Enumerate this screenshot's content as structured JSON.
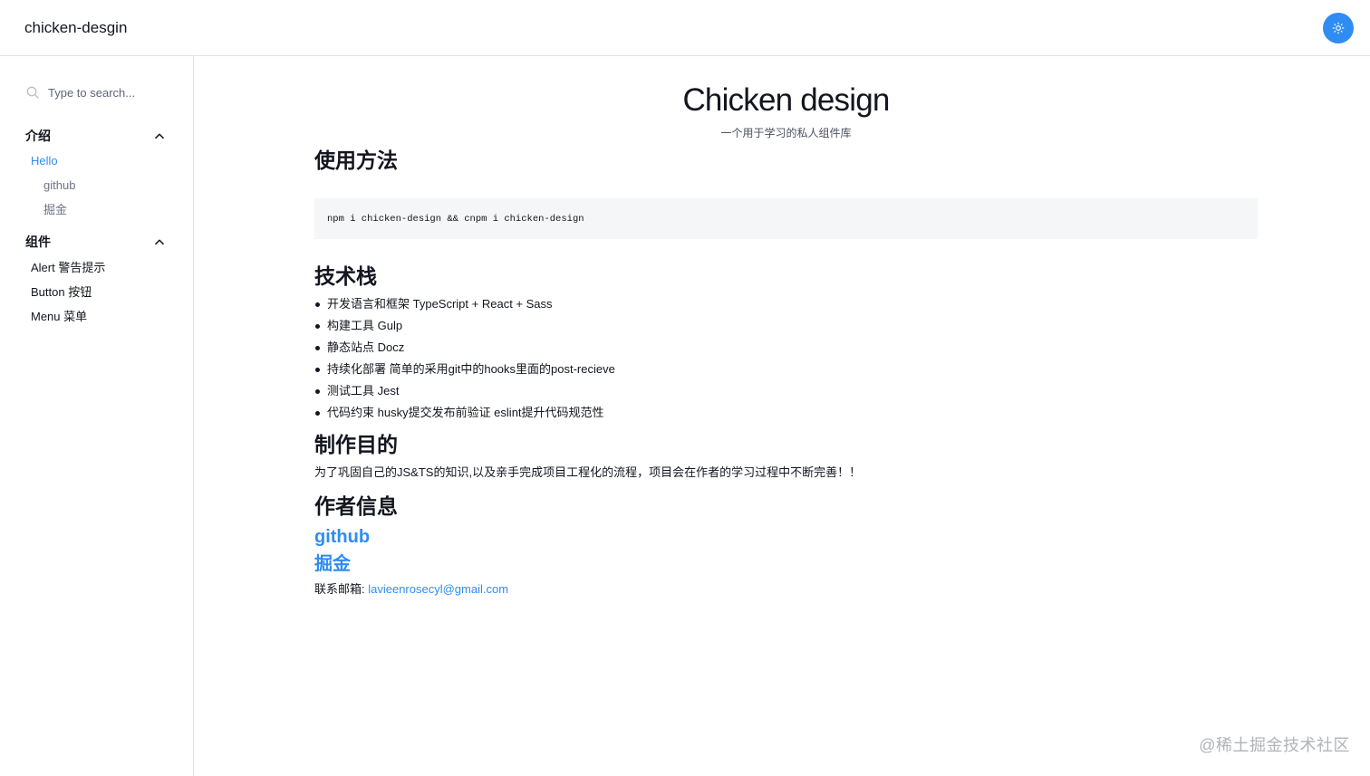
{
  "header": {
    "brand": "chicken-desgin",
    "theme_icon": "sun-icon",
    "accent_color": "#2f8cf2"
  },
  "sidebar": {
    "search_placeholder": "Type to search...",
    "search_icon": "search-icon",
    "groups": [
      {
        "title": "介绍",
        "expanded": true,
        "items": [
          {
            "label": "Hello",
            "active": true
          },
          {
            "label": "github",
            "sub": true
          },
          {
            "label": "掘金",
            "sub": true
          }
        ]
      },
      {
        "title": "组件",
        "expanded": true,
        "items": [
          {
            "label": "Alert 警告提示"
          },
          {
            "label": "Button 按钮"
          },
          {
            "label": "Menu 菜单"
          }
        ]
      }
    ]
  },
  "main": {
    "title": "Chicken design",
    "subtitle": "一个用于学习的私人组件库",
    "usage_heading": "使用方法",
    "code": "npm i chicken-design && cnpm i chicken-design",
    "stack_heading": "技术栈",
    "stack_items": [
      "开发语言和框架 TypeScript + React + Sass",
      "构建工具 Gulp",
      "静态站点 Docz",
      "持续化部署 简单的采用git中的hooks里面的post-recieve",
      "测试工具 Jest",
      "代码约束 husky提交发布前验证 eslint提升代码规范性"
    ],
    "purpose_heading": "制作目的",
    "purpose_text": "为了巩固自己的JS&TS的知识,以及亲手完成项目工程化的流程，项目会在作者的学习过程中不断完善！！",
    "author_heading": "作者信息",
    "links": [
      "github",
      "掘金"
    ],
    "contact_label": "联系邮箱: ",
    "contact_email": "lavieenrosecyl@gmail.com"
  },
  "watermark": "@稀土掘金技术社区"
}
